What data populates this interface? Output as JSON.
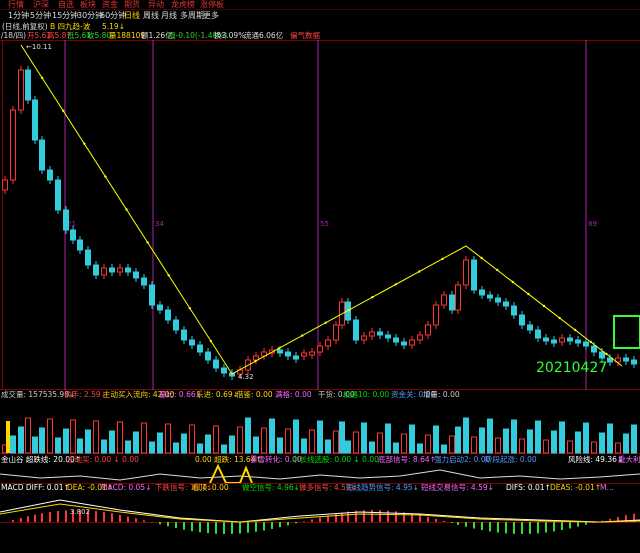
{
  "menu": [
    "行情",
    "沪深",
    "自选",
    "板块",
    "资金",
    "期货",
    "异动",
    "龙虎榜",
    "涨停板"
  ],
  "periods": [
    {
      "label": "1分钟",
      "selected": false
    },
    {
      "label": "5分钟",
      "selected": false
    },
    {
      "label": "15分钟",
      "selected": false
    },
    {
      "label": "30分钟",
      "selected": false
    },
    {
      "label": "60分钟",
      "selected": false
    },
    {
      "label": "日线",
      "selected": true
    },
    {
      "label": "周线",
      "selected": false
    },
    {
      "label": "月线",
      "selected": false
    },
    {
      "label": "多周期",
      "selected": false
    },
    {
      "label": "更多",
      "selected": false
    }
  ],
  "title_row": {
    "code": "(日线,前复权)",
    "indicator": "B 四九趋-波",
    "value": "5.19↓"
  },
  "info_row": {
    "date": "/18/四)",
    "open": "开5.61",
    "high": "高5.87",
    "low": "低5.61",
    "close": "收5.80",
    "vol": "量188109",
    "amount": "额1.26亿",
    "change": "幅-0.10(-1.48%)",
    "turnover": "换3.09%",
    "float": "流通6.06亿",
    "tag": "偏气数据"
  },
  "price_labels": {
    "high": "10.11",
    "low": "4.32"
  },
  "cycle_labels": [
    "21",
    "34",
    "55",
    "89"
  ],
  "date_annotation": "20210427",
  "volume_row": [
    {
      "text": "成交量: 157535.98↓",
      "color": "#cccccc"
    },
    {
      "text": "换手: 2.59↓",
      "color": "#ff4444"
    },
    {
      "text": "主动买入流向: 42.00",
      "color": "#ffd700"
    },
    {
      "text": "量比: 0.66↓",
      "color": "#ff66ff"
    },
    {
      "text": "乐进: 0.69↓",
      "color": "#ffd700"
    },
    {
      "text": "借鉴: 0.00",
      "color": "#ffd700"
    },
    {
      "text": "满格: 0.00",
      "color": "#ff66ff"
    },
    {
      "text": "干货: 0.00",
      "color": "#cccccc"
    },
    {
      "text": "机遇10: 0.00",
      "color": "#00dd00"
    },
    {
      "text": "资金关: 0.00",
      "color": "#5599ff"
    },
    {
      "text": "增量: 0.00",
      "color": "#cccccc"
    }
  ],
  "ind_row": [
    {
      "text": "金山谷 超跌线: 20.00↑",
      "color": "#ffffff"
    },
    {
      "text": "主动买: 0.00 ↓ 0.00",
      "color": "#ff4444"
    },
    {
      "text": "0.00 超跌: 13.64↑",
      "color": "#ffd700"
    },
    {
      "text": "暴雪转化: 0.00",
      "color": "#ff66ff"
    },
    {
      "text": "中长线选股: 0.00 ↓ 0.00",
      "color": "#00dd00"
    },
    {
      "text": "底部信号: 8.64↑",
      "color": "#ff66ff"
    },
    {
      "text": "强力启动2: 0.00",
      "color": "#5599ff"
    },
    {
      "text": "阶段起涨: 0.00",
      "color": "#5599ff"
    },
    {
      "text": "风险线: 49.36↓",
      "color": "#ffffff"
    },
    {
      "text": "重大利好",
      "color": "#ff66ff"
    }
  ],
  "macd_row": [
    {
      "text": "MACD DIFF: 0.01↑",
      "color": "#ffffff"
    },
    {
      "text": "DEA: -0.01↑",
      "color": "#ffd700"
    },
    {
      "text": "MACD: 0.05↓",
      "color": "#ff66ff"
    },
    {
      "text": "下跌信号: 1.14↓",
      "color": "#ff4444"
    },
    {
      "text": "看顶: 0.00",
      "color": "#ffd700"
    },
    {
      "text": "做空信号: 4.96↓",
      "color": "#00dd00"
    },
    {
      "text": "做多信号: 4.53↓",
      "color": "#ff4444"
    },
    {
      "text": "短线趋势信号: 4.95↓",
      "color": "#5599ff"
    },
    {
      "text": "短线交易信号: 4.59↓",
      "color": "#ff66ff"
    },
    {
      "text": "DIFS: 0.01↑",
      "color": "#ffffff"
    },
    {
      "text": "DEAS: -0.01↑",
      "color": "#ffd700"
    },
    {
      "text": "M…",
      "color": "#ff66ff"
    }
  ],
  "macd_value": "3.802",
  "colors": {
    "up": "#ff3333",
    "down": "#33ccdd",
    "grid": "#800000",
    "zigzag": "#ffff00",
    "cycle": "#aa22aa",
    "accent": "#33ff33"
  }
}
